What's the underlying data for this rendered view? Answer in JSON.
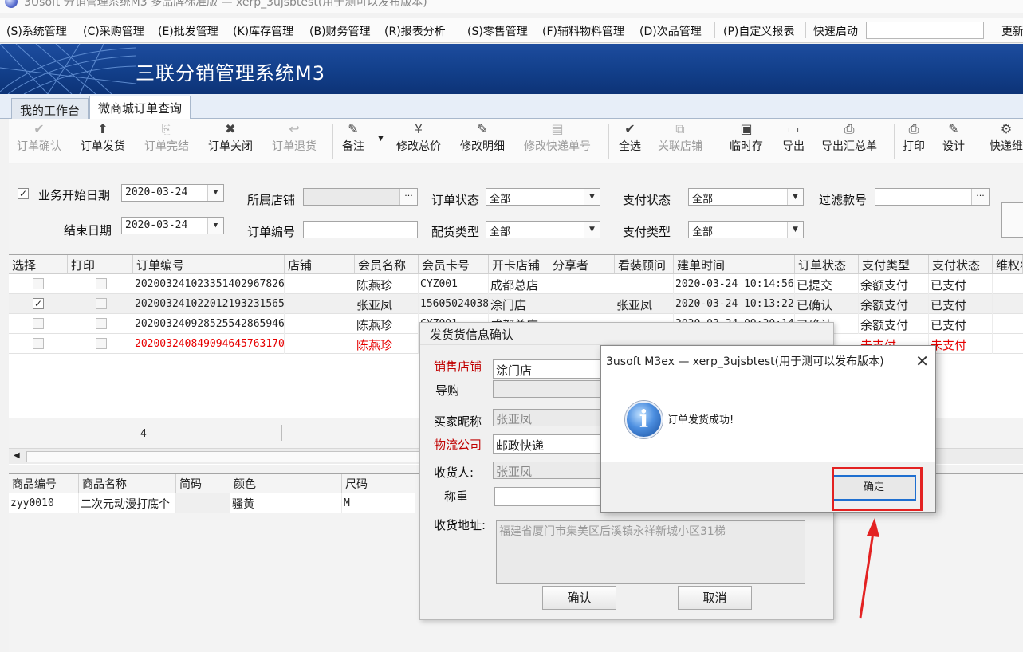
{
  "window": {
    "title": "3Usoft 分销管理系统M3 多品牌标准版 — xerp_3ujsbtest(用于测可以发布版本)"
  },
  "menu": {
    "items": [
      "(S)系统管理",
      "(C)采购管理",
      "(E)批发管理",
      "(K)库存管理",
      "(B)财务管理",
      "(R)报表分析",
      "(S)零售管理",
      "(F)辅料物料管理",
      "(D)次品管理",
      "(P)自定义报表"
    ],
    "quick_launch_label": "快速启动",
    "quick_launch_value": "",
    "more": "更新"
  },
  "banner": {
    "title": "三联分销管理系统M3"
  },
  "tabs": [
    {
      "label": "我的工作台"
    },
    {
      "label": "微商城订单查询"
    }
  ],
  "toolbar": {
    "buttons": [
      {
        "label": "订单确认",
        "icon": "✔"
      },
      {
        "label": "订单发货",
        "icon": "⬆"
      },
      {
        "label": "订单完结",
        "icon": "⎘"
      },
      {
        "label": "订单关闭",
        "icon": "✖"
      },
      {
        "label": "订单退货",
        "icon": "↩"
      },
      {
        "label": "备注",
        "icon": "✎"
      },
      {
        "label": "修改总价",
        "icon": "¥"
      },
      {
        "label": "修改明细",
        "icon": "✎"
      },
      {
        "label": "修改快递单号",
        "icon": "▤"
      },
      {
        "label": "全选",
        "icon": "✔"
      },
      {
        "label": "关联店铺",
        "icon": "⧉"
      },
      {
        "label": "临时存",
        "icon": "▣"
      },
      {
        "label": "导出",
        "icon": "▭"
      },
      {
        "label": "导出汇总单",
        "icon": "⎙"
      },
      {
        "label": "打印",
        "icon": "⎙"
      },
      {
        "label": "设计",
        "icon": "✎"
      },
      {
        "label": "快递维",
        "icon": "⚙"
      }
    ]
  },
  "filter": {
    "start_date_label": "业务开始日期",
    "start_date": "2020-03-24",
    "end_date_label": "结束日期",
    "end_date": "2020-03-24",
    "shop_label": "所属店铺",
    "order_no_label": "订单编号",
    "order_status_label": "订单状态",
    "order_status": "全部",
    "dist_type_label": "配货类型",
    "dist_type": "全部",
    "pay_status_label": "支付状态",
    "pay_status": "全部",
    "pay_type_label": "支付类型",
    "pay_type": "全部",
    "filter_style_label": "过滤款号"
  },
  "grid": {
    "headers": [
      "选择",
      "打印",
      "订单编号",
      "店铺",
      "会员名称",
      "会员卡号",
      "开卡店铺",
      "分享者",
      "看装顾问",
      "建单时间",
      "订单状态",
      "支付类型",
      "支付状态",
      "维权状"
    ],
    "rows": [
      {
        "checked": false,
        "order_no": "20200324102335140​2967826",
        "member": "陈燕珍",
        "card": "CYZ001",
        "open_shop": "成都总店",
        "advisor": "",
        "created": "2020-03-24 10:14:56",
        "status": "已提交",
        "pay_type": "余额支付",
        "pay_status": "已支付"
      },
      {
        "checked": true,
        "order_no": "2020032410220121​93231565",
        "member": "张亚凤",
        "card": "15605024038",
        "open_shop": "涂门店",
        "advisor": "张亚凤",
        "created": "2020-03-24 10:13:22",
        "status": "已确认",
        "pay_type": "余额支付",
        "pay_status": "已支付"
      },
      {
        "checked": false,
        "order_no": "20200324092852554​2865946",
        "member": "陈燕珍",
        "card": "CYZ001",
        "open_shop": "成都总店",
        "advisor": "",
        "created": "2020-03-24 09:20:14",
        "status": "已确认",
        "pay_type": "余额支付",
        "pay_status": "已支付"
      },
      {
        "checked": false,
        "order_no": "20200324084909464​5763170",
        "member": "陈燕珍",
        "card": "",
        "open_shop": "",
        "advisor": "",
        "created": "",
        "status": "",
        "pay_type": "未支付",
        "pay_status": "未支付"
      }
    ],
    "footer_count": "4"
  },
  "detail": {
    "headers": [
      "商品编号",
      "商品名称",
      "简码",
      "颜色",
      "尺码"
    ],
    "rows": [
      {
        "code": "zyy0010",
        "name": "二次元动漫打底个",
        "short": "",
        "color": "骚黄",
        "size": "M"
      }
    ]
  },
  "ship_dialog": {
    "title": "发货货信息确认",
    "sale_shop_label": "销售店铺",
    "sale_shop": "涂门店",
    "guide_label": "导购",
    "buyer_label": "买家昵称",
    "buyer": "张亚凤",
    "logistics_label": "物流公司",
    "logistics": "邮政快递",
    "receiver_label": "收货人:",
    "receiver": "张亚凤",
    "weight_label": "称重",
    "address_label": "收货地址:",
    "address": "福建省厦门市集美区后溪镇永祥新城小区31梯",
    "confirm": "确认",
    "cancel": "取消"
  },
  "msg_dialog": {
    "title": "3usoft M3ex — xerp_3ujsbtest(用于测可以发布版本)",
    "close": "✕",
    "icon": "info-icon",
    "icon_glyph": "i",
    "message": "订单发货成功!",
    "ok": "确定"
  },
  "colors": {
    "banner": "#123f8a",
    "required_label": "#c00000",
    "highlight": "#e32222"
  }
}
